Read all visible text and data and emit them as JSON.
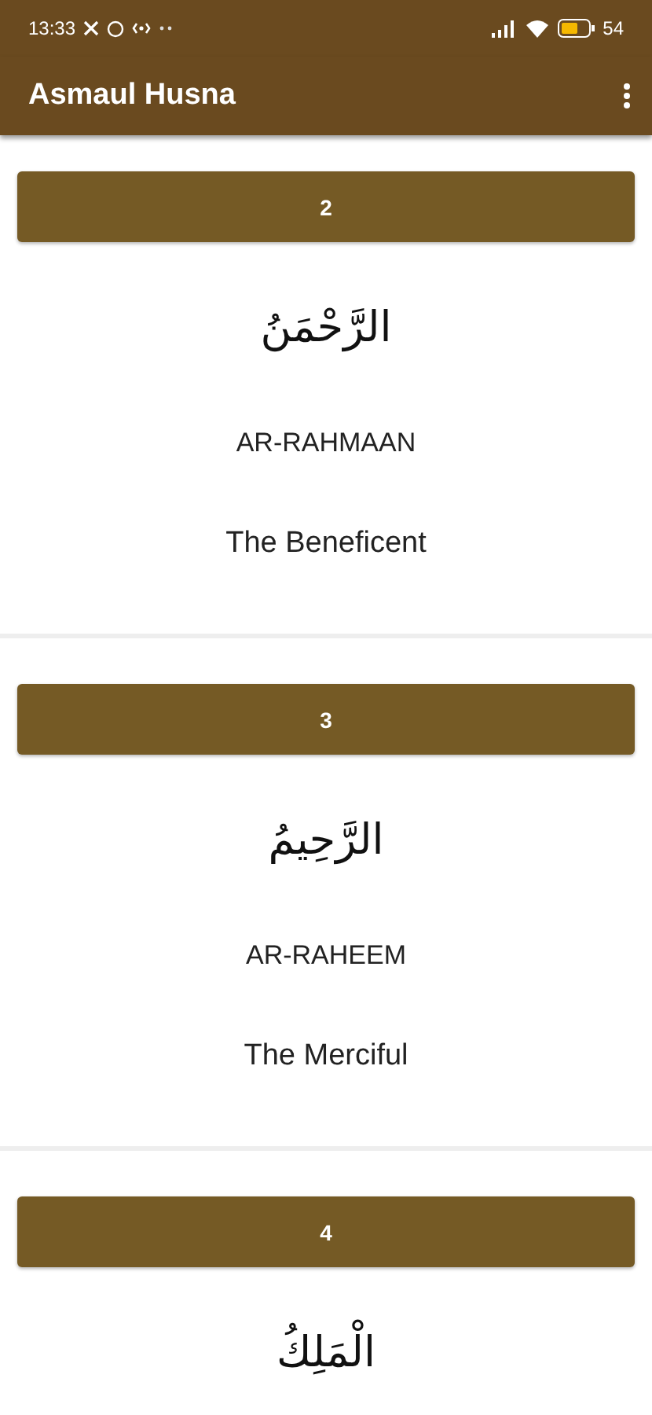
{
  "status_bar": {
    "time": "13:33",
    "battery": "54"
  },
  "app_bar": {
    "title": "Asmaul Husna"
  },
  "names": [
    {
      "number": "2",
      "arabic": "الرَّحْمَنُ",
      "transliteration": "AR-RAHMAAN",
      "meaning": "The Beneficent"
    },
    {
      "number": "3",
      "arabic": "الرَّحِيمُ",
      "transliteration": "AR-RAHEEM",
      "meaning": "The Merciful"
    },
    {
      "number": "4",
      "arabic": "الْمَلِكُ"
    }
  ]
}
